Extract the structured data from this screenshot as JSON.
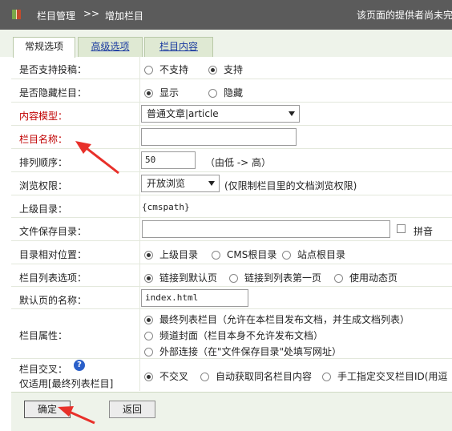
{
  "header": {
    "crumb_main": "栏目管理",
    "separator": ">>",
    "crumb_current": "增加栏目",
    "notice": "该页面的提供者尚未完"
  },
  "tabs": [
    {
      "label": "常规选项",
      "active": true
    },
    {
      "label": "高级选项",
      "active": false
    },
    {
      "label": "栏目内容",
      "active": false
    }
  ],
  "form": {
    "allow_submit": {
      "label": "是否支持投稿：",
      "options": [
        "不支持",
        "支持"
      ],
      "selected": "支持"
    },
    "hide_column": {
      "label": "是否隐藏栏目：",
      "options": [
        "显示",
        "隐藏"
      ],
      "selected": "显示"
    },
    "content_model": {
      "label": "内容模型：",
      "value": "普通文章|article"
    },
    "column_name": {
      "label": "栏目名称：",
      "value": ""
    },
    "sort_order": {
      "label": "排列顺序：",
      "value": "50",
      "hint": "（由低 -> 高）"
    },
    "browse_permission": {
      "label": "浏览权限：",
      "value": "开放浏览",
      "hint": "(仅限制栏目里的文档浏览权限)"
    },
    "parent_dir": {
      "label": "上级目录：",
      "value": "{cmspath}"
    },
    "save_dir": {
      "label": "文件保存目录：",
      "value": "",
      "pinyin_label": "拼音"
    },
    "relative_pos": {
      "label": "目录相对位置：",
      "options": [
        "上级目录",
        "CMS根目录",
        "站点根目录"
      ],
      "selected": "上级目录"
    },
    "list_option": {
      "label": "栏目列表选项：",
      "options": [
        "链接到默认页",
        "链接到列表第一页",
        "使用动态页"
      ],
      "selected": "链接到默认页"
    },
    "default_page": {
      "label": "默认页的名称：",
      "value": "index.html"
    },
    "column_attr": {
      "label": "栏目属性：",
      "options": [
        "最终列表栏目（允许在本栏目发布文档，并生成文档列表）",
        "频道封面（栏目本身不允许发布文档）",
        "外部连接（在\"文件保存目录\"处填写网址）"
      ],
      "selected": "最终列表栏目（允许在本栏目发布文档，并生成文档列表）"
    },
    "cross": {
      "label": "栏目交叉：",
      "sublabel": "仅适用[最终列表栏目]",
      "help": "?",
      "options": [
        "不交叉",
        "自动获取同名栏目内容",
        "手工指定交叉栏目ID(用逗"
      ],
      "selected": "不交叉"
    }
  },
  "buttons": {
    "ok": "确定",
    "back": "返回"
  },
  "colors": {
    "header_bg": "#5b5b5b",
    "red_label": "#c00000",
    "arrow": "#e8302a",
    "panel_bg": "#eef3ea"
  }
}
